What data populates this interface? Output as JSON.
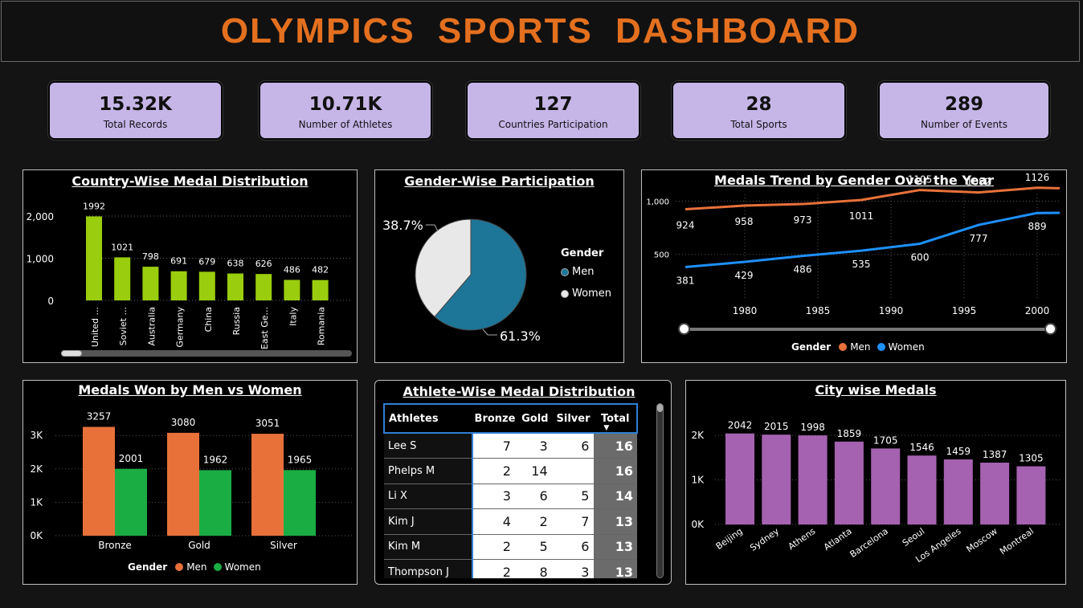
{
  "header": {
    "title": "OLYMPICS  SPORTS  DASHBOARD"
  },
  "kpis": [
    {
      "value": "15.32K",
      "label": "Total Records"
    },
    {
      "value": "10.71K",
      "label": "Number of Athletes"
    },
    {
      "value": "127",
      "label": "Countries Participation"
    },
    {
      "value": "28",
      "label": "Total Sports"
    },
    {
      "value": "289",
      "label": "Number of Events"
    }
  ],
  "country_chart": {
    "title": "Country-Wise Medal Distribution",
    "chart_data": {
      "type": "bar",
      "categories": [
        "United ...",
        "Soviet ...",
        "Australia",
        "Germany",
        "China",
        "Russia",
        "East Ge...",
        "Italy",
        "Romania"
      ],
      "values": [
        1992,
        1021,
        798,
        691,
        679,
        638,
        626,
        486,
        482
      ],
      "y_ticks": [
        "0",
        "1,000",
        "2,000"
      ],
      "ylim": [
        0,
        2300
      ],
      "color": "#9acd0e"
    }
  },
  "gender_pie": {
    "title": "Gender-Wise Participation",
    "legend_title": "Gender",
    "chart_data": {
      "type": "pie",
      "labels": [
        "Men",
        "Women"
      ],
      "values": [
        61.3,
        38.7
      ],
      "display": [
        "61.3%",
        "38.7%"
      ],
      "colors": [
        "#1d7697",
        "#e8e8e8"
      ]
    }
  },
  "trend_chart": {
    "title": "Medals Trend by Gender Over the Year",
    "legend_title": "Gender",
    "chart_data": {
      "type": "line",
      "x_ticks": [
        "1980",
        "1985",
        "1990",
        "1995",
        "2000"
      ],
      "y_ticks": [
        "500",
        "1,000"
      ],
      "series": [
        {
          "name": "Men",
          "color": "#e8713a",
          "labels": [
            "924",
            "958",
            "973",
            "1011",
            "1105",
            "1082",
            "1126"
          ],
          "values": [
            924,
            958,
            973,
            1011,
            1105,
            1082,
            1126
          ]
        },
        {
          "name": "Women",
          "color": "#1e90ff",
          "labels": [
            "381",
            "429",
            "486",
            "535",
            "600",
            "777",
            "889"
          ],
          "values": [
            381,
            429,
            486,
            535,
            600,
            777,
            889
          ]
        }
      ]
    }
  },
  "menwomen_chart": {
    "title": "Medals Won by Men vs Women",
    "legend_title": "Gender",
    "chart_data": {
      "type": "bar",
      "categories": [
        "Bronze",
        "Gold",
        "Silver"
      ],
      "y_ticks": [
        "0K",
        "1K",
        "2K",
        "3K"
      ],
      "ylim": [
        0,
        3600
      ],
      "series": [
        {
          "name": "Men",
          "color": "#e8713a",
          "values": [
            3257,
            3080,
            3051
          ]
        },
        {
          "name": "Women",
          "color": "#1aad44",
          "values": [
            2001,
            1962,
            1965
          ]
        }
      ]
    }
  },
  "athlete_table": {
    "title": "Athlete-Wise Medal Distribution",
    "headers": [
      "Athletes",
      "Bronze",
      "Gold",
      "Silver",
      "Total"
    ],
    "rows": [
      [
        "Lee S",
        "7",
        "3",
        "6",
        "16"
      ],
      [
        "Phelps M",
        "2",
        "14",
        "",
        "16"
      ],
      [
        "Li X",
        "3",
        "6",
        "5",
        "14"
      ],
      [
        "Kim J",
        "4",
        "2",
        "7",
        "13"
      ],
      [
        "Kim M",
        "2",
        "5",
        "6",
        "13"
      ],
      [
        "Thompson J",
        "2",
        "8",
        "3",
        "13"
      ]
    ]
  },
  "city_chart": {
    "title": "City wise Medals",
    "chart_data": {
      "type": "bar",
      "categories": [
        "Beijing",
        "Sydney",
        "Athens",
        "Atlanta",
        "Barcelona",
        "Seoul",
        "Los Angeles",
        "Moscow",
        "Montreal"
      ],
      "values": [
        2042,
        2015,
        1998,
        1859,
        1705,
        1546,
        1459,
        1387,
        1305
      ],
      "y_ticks": [
        "0K",
        "1K",
        "2K"
      ],
      "ylim": [
        0,
        2200
      ],
      "color": "#a562b0"
    }
  }
}
